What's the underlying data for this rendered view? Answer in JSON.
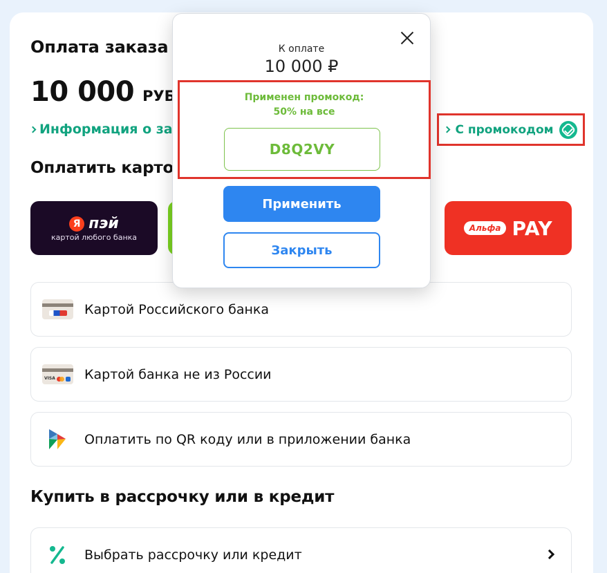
{
  "order": {
    "title": "Оплата заказа",
    "title_rest": "№",
    "amount": "10 000",
    "currency": "РУБ",
    "info_link": "Информация о зака"
  },
  "promo_link": {
    "label": "С промокодом",
    "icon": "promo-check-badge-icon"
  },
  "pay_card_section": {
    "title": "Оплатить картой",
    "wallets": [
      {
        "name": "Я Пэй",
        "logo_letter": "Я",
        "word": "пэй",
        "subtitle": "картой любого банка",
        "color": "#1b0a26"
      },
      {
        "name": "Alfa Pay",
        "pill": "Альфа",
        "word": "PAY",
        "color": "#ef3124"
      }
    ]
  },
  "options": [
    {
      "label": "Картой Российского банка",
      "icon": "card-mir-icon"
    },
    {
      "label": "Картой банка не из России",
      "icon": "card-visa-mastercard-icon",
      "mini": "VISA"
    },
    {
      "label": "Оплатить по QR коду или в приложении банка",
      "icon": "sbp-icon"
    }
  ],
  "installment_section": {
    "title": "Купить в рассрочку или в кредит",
    "option_label": "Выбрать рассрочку или кредит",
    "icon": "percent-icon"
  },
  "modal": {
    "label": "К оплате",
    "amount": "10 000 ₽",
    "applied_line1": "Применен промокод:",
    "applied_line2": "50% на все",
    "promo_code": "D8Q2VY",
    "apply_button": "Применить",
    "close_button": "Закрыть"
  },
  "colors": {
    "accent_green": "#11a37f",
    "promo_green": "#6dbb3a",
    "button_blue": "#2e86f0",
    "highlight_red": "#e0342c"
  }
}
